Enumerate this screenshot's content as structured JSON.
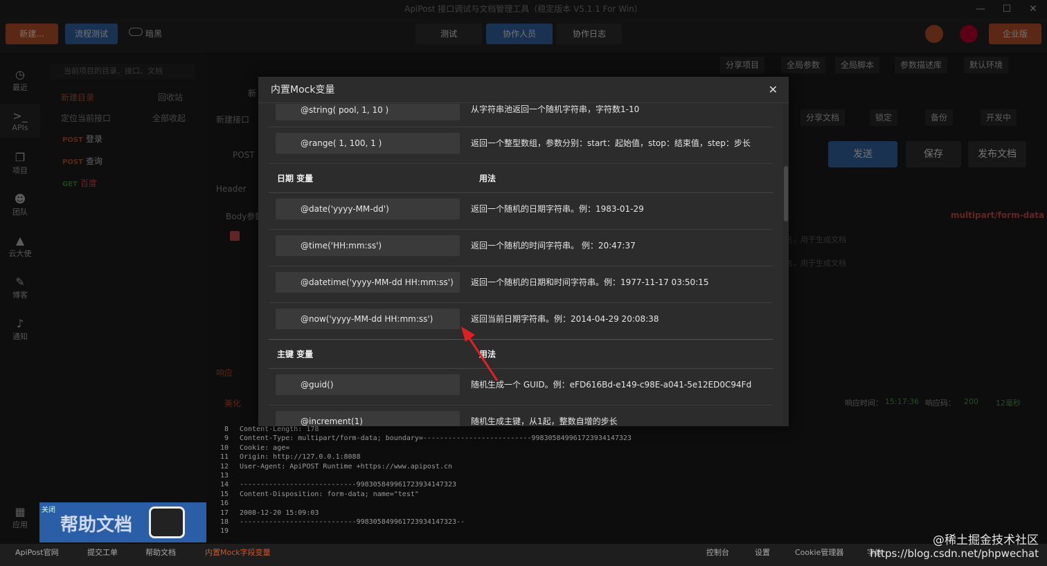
{
  "window": {
    "title": "ApiPost 接口调试与文档管理工具（稳定版本 V5.1.1 For Win）"
  },
  "toolbar": {
    "new_label": "新建...",
    "flow_test_label": "流程测试",
    "dark_label": "暗黑",
    "test_label": "测试",
    "collaborators_label": "协作人员",
    "collab_log_label": "协作日志",
    "enterprise_label": "企业版"
  },
  "subtoolbar": {
    "share_project": "分享项目",
    "global_params": "全局参数",
    "global_script": "全局脚本",
    "param_lib": "参数描述库",
    "env": "默认环境"
  },
  "sidebar": {
    "items": [
      {
        "label": "最近",
        "icon": "clock-icon"
      },
      {
        "label": "APIs",
        "icon": "terminal-icon"
      },
      {
        "label": "项目",
        "icon": "project-icon"
      },
      {
        "label": "团队",
        "icon": "team-icon"
      },
      {
        "label": "云大使",
        "icon": "graduation-icon"
      },
      {
        "label": "博客",
        "icon": "edit-icon"
      },
      {
        "label": "通知",
        "icon": "bell-icon"
      },
      {
        "label": "应用",
        "icon": "apps-icon"
      }
    ]
  },
  "tree": {
    "search_placeholder": "当前项目的目录、接口、文档",
    "new_dir": "新建目录",
    "recycle": "回收站",
    "locate": "定位当前接口",
    "collapse_all": "全部收起",
    "items": [
      {
        "method": "POST",
        "name": "登录"
      },
      {
        "method": "POST",
        "name": "查询"
      },
      {
        "method": "GET",
        "name": "百度"
      }
    ]
  },
  "main": {
    "tab_new": "新",
    "new_api": "新建接口",
    "method": "POST",
    "header_tab": "Header",
    "body_tab": "Body参数",
    "content_type": "multipart/form-data",
    "share_doc": "分享文档",
    "lock": "锁定",
    "backup": "备份",
    "dev_status": "开发中",
    "send": "发送",
    "save": "保存",
    "publish": "发布文档",
    "hint1": "名，用于生成文档",
    "hint2": "名，用于生成文档",
    "resp_tab": "响应",
    "beautify": "美化",
    "resp_time_label": "响应时间：",
    "resp_time": "15:17:36",
    "resp_code_label": "响应码：",
    "resp_code": "200",
    "resp_ms": "12毫秒"
  },
  "code": {
    "lines": [
      {
        "n": "8",
        "t": "Content-Length: 178"
      },
      {
        "n": "9",
        "t": "Content-Type: multipart/form-data; boundary=--------------------------998305849961723934147323"
      },
      {
        "n": "10",
        "t": "Cookie: age="
      },
      {
        "n": "11",
        "t": "Origin: http://127.0.0.1:8088"
      },
      {
        "n": "12",
        "t": "User-Agent: ApiPOST Runtime +https://www.apipost.cn"
      },
      {
        "n": "13",
        "t": ""
      },
      {
        "n": "14",
        "t": "----------------------------998305849961723934147323"
      },
      {
        "n": "15",
        "t": "Content-Disposition: form-data; name=\"test\""
      },
      {
        "n": "16",
        "t": ""
      },
      {
        "n": "17",
        "t": "2008-12-20 15:09:03"
      },
      {
        "n": "18",
        "t": "----------------------------998305849961723934147323--"
      },
      {
        "n": "19",
        "t": ""
      }
    ]
  },
  "modal": {
    "title": "内置Mock变量",
    "rows_top": [
      {
        "k": "@string( pool, 1, 10 )",
        "v": "从字符串池返回一个随机字符串，字符数1-10"
      },
      {
        "k": "@range( 1, 100, 1 )",
        "v": "返回一个整型数组，参数分别：start：起始值，stop：结束值，step：步长"
      }
    ],
    "sec_date": {
      "a": "日期 变量",
      "b": "用法"
    },
    "rows_date": [
      {
        "k": "@date('yyyy-MM-dd')",
        "v": "返回一个随机的日期字符串。例：1983-01-29"
      },
      {
        "k": "@time('HH:mm:ss')",
        "v": "返回一个随机的时间字符串。 例：20:47:37"
      },
      {
        "k": "@datetime('yyyy-MM-dd HH:mm:ss')",
        "v": "返回一个随机的日期和时间字符串。例：1977-11-17 03:50:15"
      },
      {
        "k": "@now('yyyy-MM-dd HH:mm:ss')",
        "v": "返回当前日期字符串。例：2014-04-29 20:08:38"
      }
    ],
    "sec_key": {
      "a": "主键 变量",
      "b": "用法"
    },
    "rows_key": [
      {
        "k": "@guid()",
        "v": "随机生成一个 GUID。例：eFD616Bd-e149-c98E-a041-5e12ED0C94Fd"
      },
      {
        "k": "@increment(1)",
        "v": "随机生成主键，从1起，整数自增的步长"
      }
    ]
  },
  "help": {
    "close": "关闭",
    "text": "帮助文档"
  },
  "footer": {
    "official": "ApiPost官网",
    "ticket": "提交工单",
    "help_doc": "帮助文档",
    "mock": "内置Mock字段变量",
    "console": "控制台",
    "settings": "设置",
    "cookie": "Cookie管理器",
    "font": "字体"
  },
  "watermark": {
    "line1": "@稀土掘金技术社区",
    "line2": "https://blog.csdn.net/phpwechat"
  },
  "colors": {
    "accent_red": "#d9534f",
    "brand_blue": "#3a6fb5",
    "orange": "#c8582c"
  }
}
